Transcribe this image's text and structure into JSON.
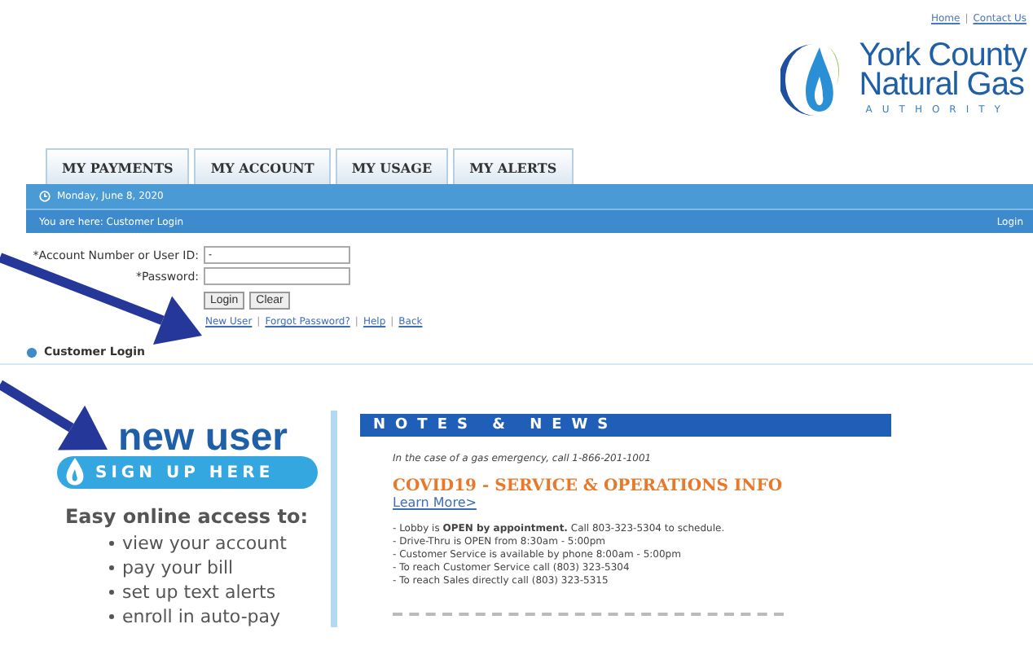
{
  "top_links": [
    {
      "kind": "link",
      "text": "Home"
    },
    {
      "kind": "separator",
      "text": "|"
    },
    {
      "kind": "link",
      "text": "Contact Us"
    }
  ],
  "logo": {
    "line1": "York County",
    "line2": "Natural Gas",
    "line3": "AUTHORITY"
  },
  "tabs": [
    "MY PAYMENTS",
    "MY ACCOUNT",
    "MY USAGE",
    "MY ALERTS"
  ],
  "date_bar": {
    "date": "Monday, June 8, 2020"
  },
  "breadcrumb_bar": {
    "text": "You are here: Customer Login",
    "right_link": "Login"
  },
  "login_form": {
    "fields": [
      {
        "label": "*Account Number or User ID:",
        "value": "-"
      },
      {
        "label": "*Password:"
      }
    ],
    "buttons": [
      "Login",
      "Clear"
    ],
    "links": [
      {
        "kind": "link",
        "text": "New User"
      },
      {
        "kind": "separator",
        "text": "|"
      },
      {
        "kind": "link",
        "text": "Forgot Password?"
      },
      {
        "kind": "separator",
        "text": "|"
      },
      {
        "kind": "link",
        "text": "Help"
      },
      {
        "kind": "separator",
        "text": "|"
      },
      {
        "kind": "link",
        "text": "Back"
      }
    ]
  },
  "section_title": "Customer Login",
  "promo": {
    "title": "new user",
    "banner": "SIGN UP HERE",
    "heading": "Easy online access to:",
    "items": [
      "view your account",
      "pay your bill",
      "set up text alerts",
      "enroll in auto-pay"
    ]
  },
  "notes": {
    "header": "NOTES & NEWS",
    "emergency": "In the case of a gas emergency, call 1-866-201-1001",
    "headline": "COVID19 -  SERVICE & OPERATIONS INFO",
    "link": "Learn More>",
    "lines": [
      "- Lobby is **OPEN by appointment.**  Call 803-323-5304 to schedule.",
      "- Drive-Thru is OPEN from 8:30am - 5:00pm",
      "- Customer Service is available by phone 8:00am - 5:00pm",
      "- To reach Customer Service call (803) 323-5304",
      "- To reach Sales directly call (803) 323-5315"
    ]
  }
}
